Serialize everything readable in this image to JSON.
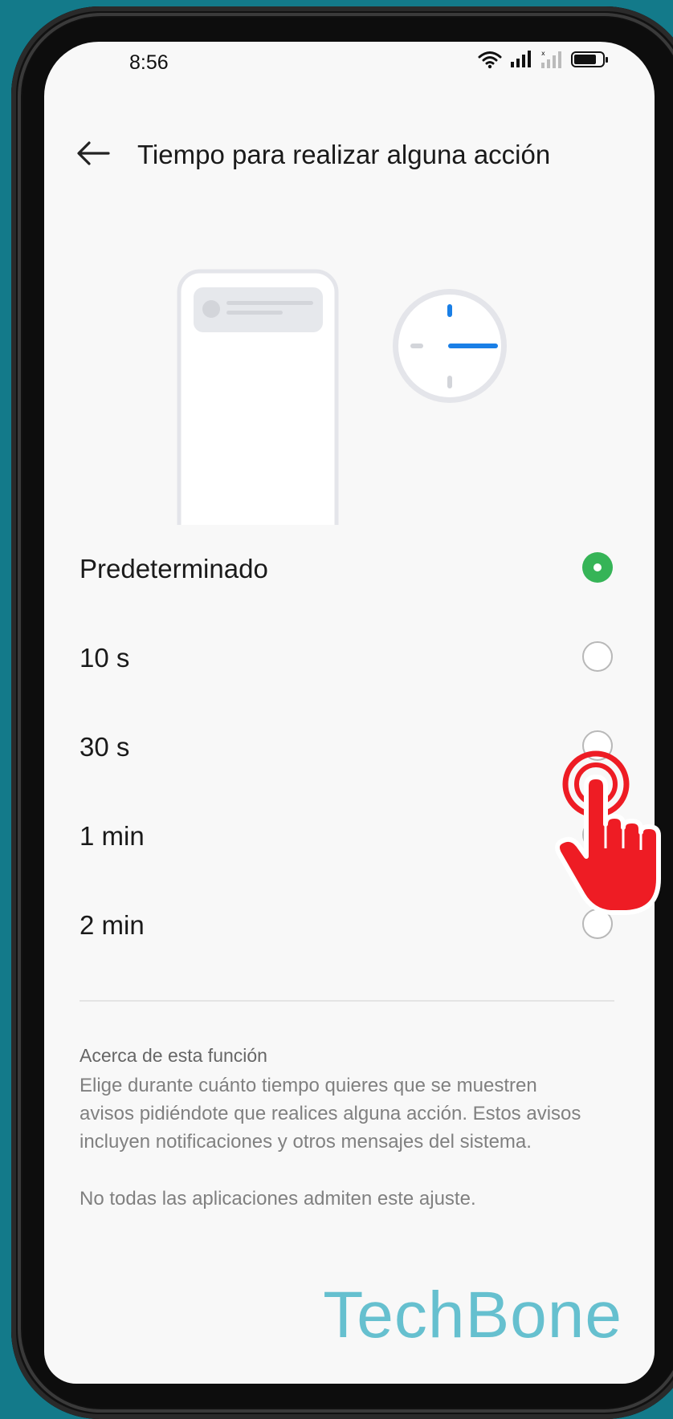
{
  "status_bar": {
    "time": "8:56"
  },
  "header": {
    "title": "Tiempo para realizar alguna acción"
  },
  "options": [
    {
      "label": "Predeterminado",
      "selected": true
    },
    {
      "label": "10 s",
      "selected": false
    },
    {
      "label": "30 s",
      "selected": false
    },
    {
      "label": "1 min",
      "selected": false
    },
    {
      "label": "2 min",
      "selected": false
    }
  ],
  "about": {
    "heading": "Acerca de esta función",
    "body": "Elige durante cuánto tiempo quieres que se muestren avisos pidiéndote que realices alguna acción. Estos avisos incluyen notificaciones y otros mensajes del sistema.",
    "note": "No todas las aplicaciones admiten este ajuste."
  },
  "watermark": "TechBone",
  "colors": {
    "accent_green": "#36b457",
    "clock_blue": "#1a7fe6",
    "pointer_red": "#ee1c24",
    "background": "#137a8a"
  },
  "icons": {
    "back": "arrow-left-icon",
    "wifi": "wifi-icon",
    "signal": "signal-icon",
    "battery": "battery-icon"
  }
}
